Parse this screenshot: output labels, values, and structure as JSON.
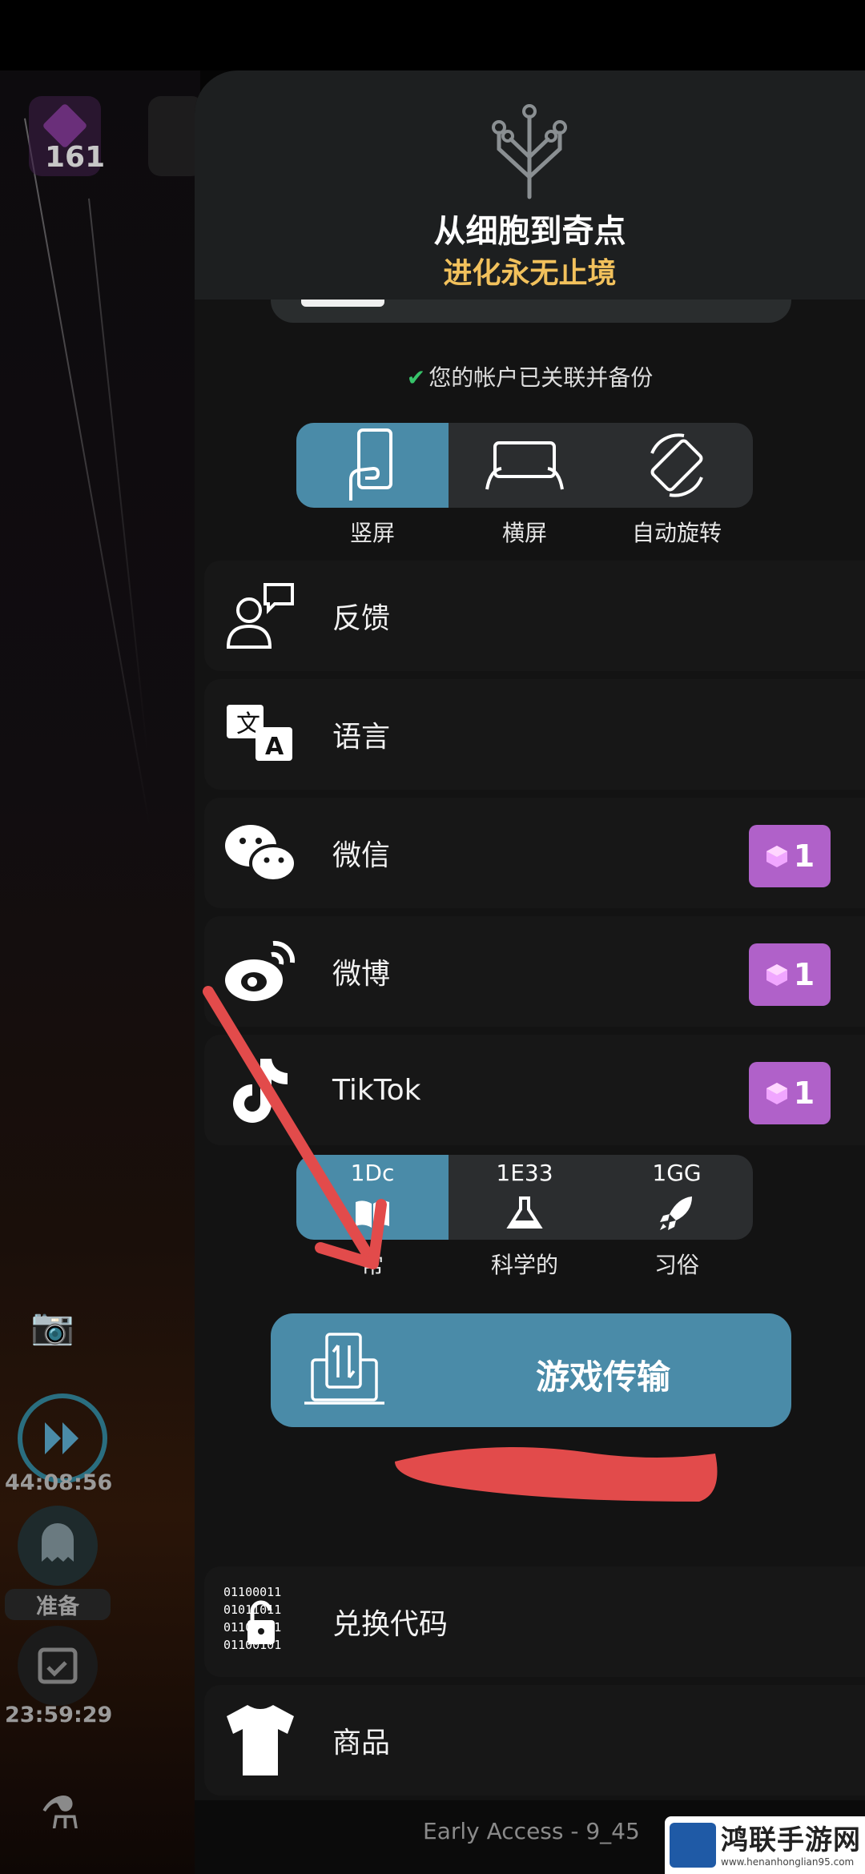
{
  "hud": {
    "gem_count": "161",
    "timer1": "44:08:56",
    "ready_label": "准备",
    "timer2": "23:59:29"
  },
  "header": {
    "title": "从细胞到奇点",
    "subtitle": "进化永无止境"
  },
  "account": {
    "note": "您的帐户已关联并备份"
  },
  "orientation": {
    "items": [
      {
        "label": "竖屏",
        "icon": "portrait-phone-icon",
        "active": true
      },
      {
        "label": "横屏",
        "icon": "landscape-phone-icon",
        "active": false
      },
      {
        "label": "自动旋转",
        "icon": "rotate-icon",
        "active": false
      }
    ]
  },
  "menu": {
    "feedback": "反馈",
    "language": "语言",
    "wechat": "微信",
    "weibo": "微博",
    "tiktok": "TikTok",
    "badge_value": "1",
    "redeem": "兑换代码",
    "merch": "商品"
  },
  "number_format": {
    "items": [
      {
        "value": "1Dc",
        "label": "常",
        "icon": "book-icon",
        "active": true
      },
      {
        "value": "1E33",
        "label": "科学的",
        "icon": "flask-icon",
        "active": false
      },
      {
        "value": "1GG",
        "label": "习俗",
        "icon": "rocket-icon",
        "active": false
      }
    ]
  },
  "transfer": {
    "label": "游戏传输"
  },
  "footer": {
    "version": "Early Access - 9_45"
  },
  "watermark": {
    "title": "鸿联手游网",
    "url": "www.henanhonglian95.com"
  },
  "colors": {
    "accent": "#4a8ba8",
    "badge": "#b061c9",
    "gold": "#f2c15c",
    "annotation": "#e24b4b"
  }
}
